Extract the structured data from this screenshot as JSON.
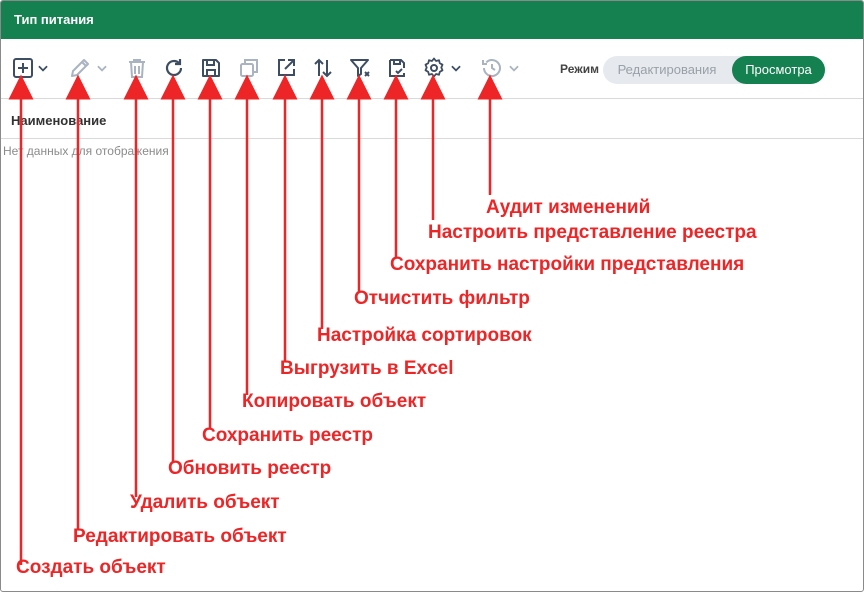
{
  "window": {
    "title": "Тип питания"
  },
  "toolbar": {
    "buttons": [
      {
        "id": "create",
        "icon": "plus-square-icon",
        "has_dropdown": true
      },
      {
        "id": "edit",
        "icon": "pencil-icon",
        "has_dropdown": true,
        "disabled": true
      },
      {
        "id": "delete",
        "icon": "trash-icon",
        "disabled": true
      },
      {
        "id": "refresh",
        "icon": "refresh-icon"
      },
      {
        "id": "save",
        "icon": "floppy-disk-icon"
      },
      {
        "id": "copy",
        "icon": "copy-icon",
        "disabled": true
      },
      {
        "id": "export",
        "icon": "external-link-icon"
      },
      {
        "id": "sort",
        "icon": "sort-arrows-icon"
      },
      {
        "id": "clear_filter",
        "icon": "filter-clear-icon"
      },
      {
        "id": "save_view",
        "icon": "save-view-icon"
      },
      {
        "id": "view_settings",
        "icon": "gear-icon",
        "has_dropdown": true
      },
      {
        "id": "audit",
        "icon": "history-icon",
        "has_dropdown": true,
        "disabled": true
      }
    ],
    "mode_label": "Режим",
    "mode_edit": "Редактирования",
    "mode_view": "Просмотра",
    "mode_active": "view"
  },
  "table": {
    "columns": [
      "Наименование"
    ],
    "empty_text": "Нет данных для отображения"
  },
  "annotations": {
    "color": "#ee2526",
    "callouts": [
      "Аудит изменений",
      "Настроить представление реестра",
      "Сохранить настройки представления",
      "Отчистить фильтр",
      "Настройка сортировок",
      "Выгрузить в Excel",
      "Копировать объект",
      "Сохранить реестр",
      "Обновить реестр",
      "Удалить объект",
      "Редактировать объект",
      "Создать объект"
    ]
  },
  "colors": {
    "header_bg": "#168150",
    "toggle_active": "#168150",
    "icon": "#3d4e63",
    "icon_disabled": "#a9b3c1"
  }
}
